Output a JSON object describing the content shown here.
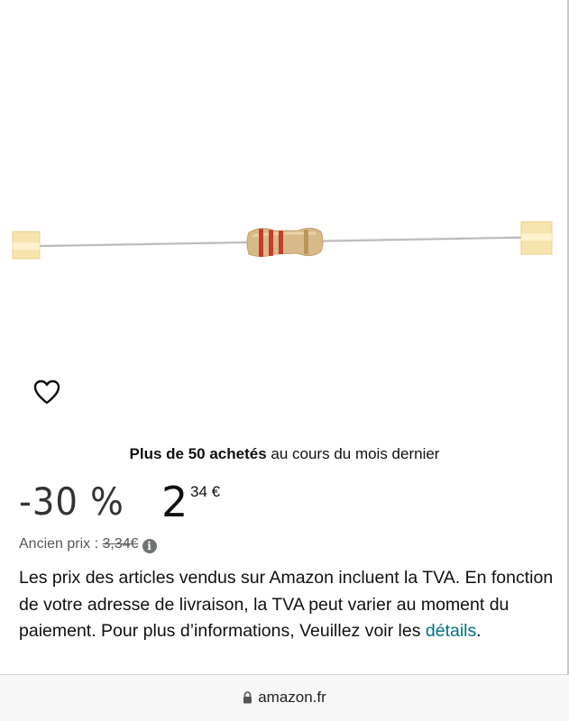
{
  "product": {
    "image_alt": "resistor",
    "bought_bold": "Plus de 50 achetés",
    "bought_rest": " au cours du mois dernier"
  },
  "price": {
    "discount": "-30 %",
    "integer": "2",
    "fraction": "34 €",
    "old_label": "Ancien prix : ",
    "old_value": "3,34€"
  },
  "vat": {
    "text": "Les prix des articles vendus sur Amazon incluent la TVA. En fonction de votre adresse de livraison, la TVA peut varier au moment du paiement. Pour plus d’informations, Veuillez voir les ",
    "link": "détails",
    "end": "."
  },
  "browser": {
    "domain": "amazon.fr"
  },
  "colors": {
    "link": "#007185",
    "text": "#0f1111",
    "muted": "#565959"
  }
}
